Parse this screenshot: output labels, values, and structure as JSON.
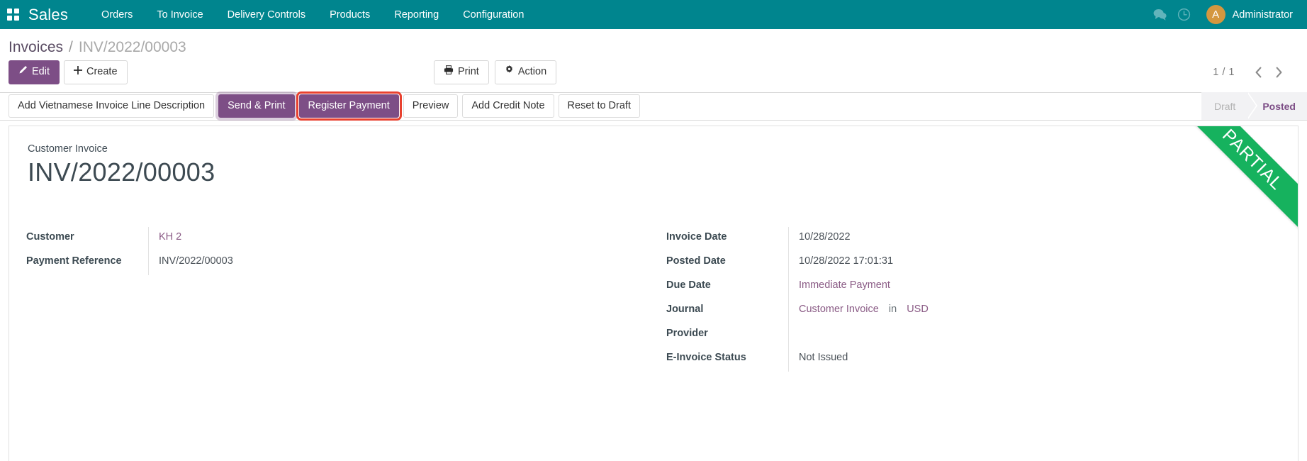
{
  "navbar": {
    "apps_icon": "apps-grid-icon",
    "brand": "Sales",
    "menu": [
      {
        "label": "Orders"
      },
      {
        "label": "To Invoice"
      },
      {
        "label": "Delivery Controls"
      },
      {
        "label": "Products"
      },
      {
        "label": "Reporting"
      },
      {
        "label": "Configuration"
      }
    ],
    "messages_icon": "messages-icon",
    "activities_icon": "clock-icon",
    "avatar_initial": "A",
    "user_name": "Administrator"
  },
  "control_panel": {
    "breadcrumb": {
      "root": "Invoices",
      "separator": "/",
      "current": "INV/2022/00003"
    },
    "edit_label": "Edit",
    "create_label": "Create",
    "print_label": "Print",
    "action_label": "Action",
    "pager": {
      "count": "1 / 1",
      "prev_icon": "chevron-left-icon",
      "next_icon": "chevron-right-icon"
    }
  },
  "statusbar": {
    "buttons": [
      {
        "label": "Add Vietnamese Invoice Line Description",
        "style": "default",
        "highlighted": false
      },
      {
        "label": "Send & Print",
        "style": "purple",
        "highlighted": false
      },
      {
        "label": "Register Payment",
        "style": "purple",
        "highlighted": true
      },
      {
        "label": "Preview",
        "style": "default",
        "highlighted": false
      },
      {
        "label": "Add Credit Note",
        "style": "default",
        "highlighted": false
      },
      {
        "label": "Reset to Draft",
        "style": "default",
        "highlighted": false
      }
    ],
    "states": [
      {
        "label": "Draft",
        "active": false
      },
      {
        "label": "Posted",
        "active": true
      }
    ],
    "highlight_color": "#e8412f",
    "accent_color": "#7d4e86"
  },
  "sheet": {
    "ribbon": "PARTIAL",
    "ribbon_color": "#16b25e",
    "subtitle": "Customer Invoice",
    "title": "INV/2022/00003",
    "left_fields": [
      {
        "label": "Customer",
        "value": "KH 2",
        "is_link": true
      },
      {
        "label": "Payment Reference",
        "value": "INV/2022/00003",
        "is_link": false
      }
    ],
    "right_fields": [
      {
        "label": "Invoice Date",
        "value": "10/28/2022",
        "is_link": false
      },
      {
        "label": "Posted Date",
        "value": "10/28/2022 17:01:31",
        "is_link": false
      },
      {
        "label": "Due Date",
        "value": "Immediate Payment",
        "is_link": true
      },
      {
        "label": "Journal",
        "value": "Customer Invoice",
        "is_link": true,
        "join": "in",
        "extra": "USD"
      },
      {
        "label": "Provider",
        "value": "",
        "is_link": false
      },
      {
        "label": "E-Invoice Status",
        "value": "Not Issued",
        "is_link": false
      }
    ]
  }
}
